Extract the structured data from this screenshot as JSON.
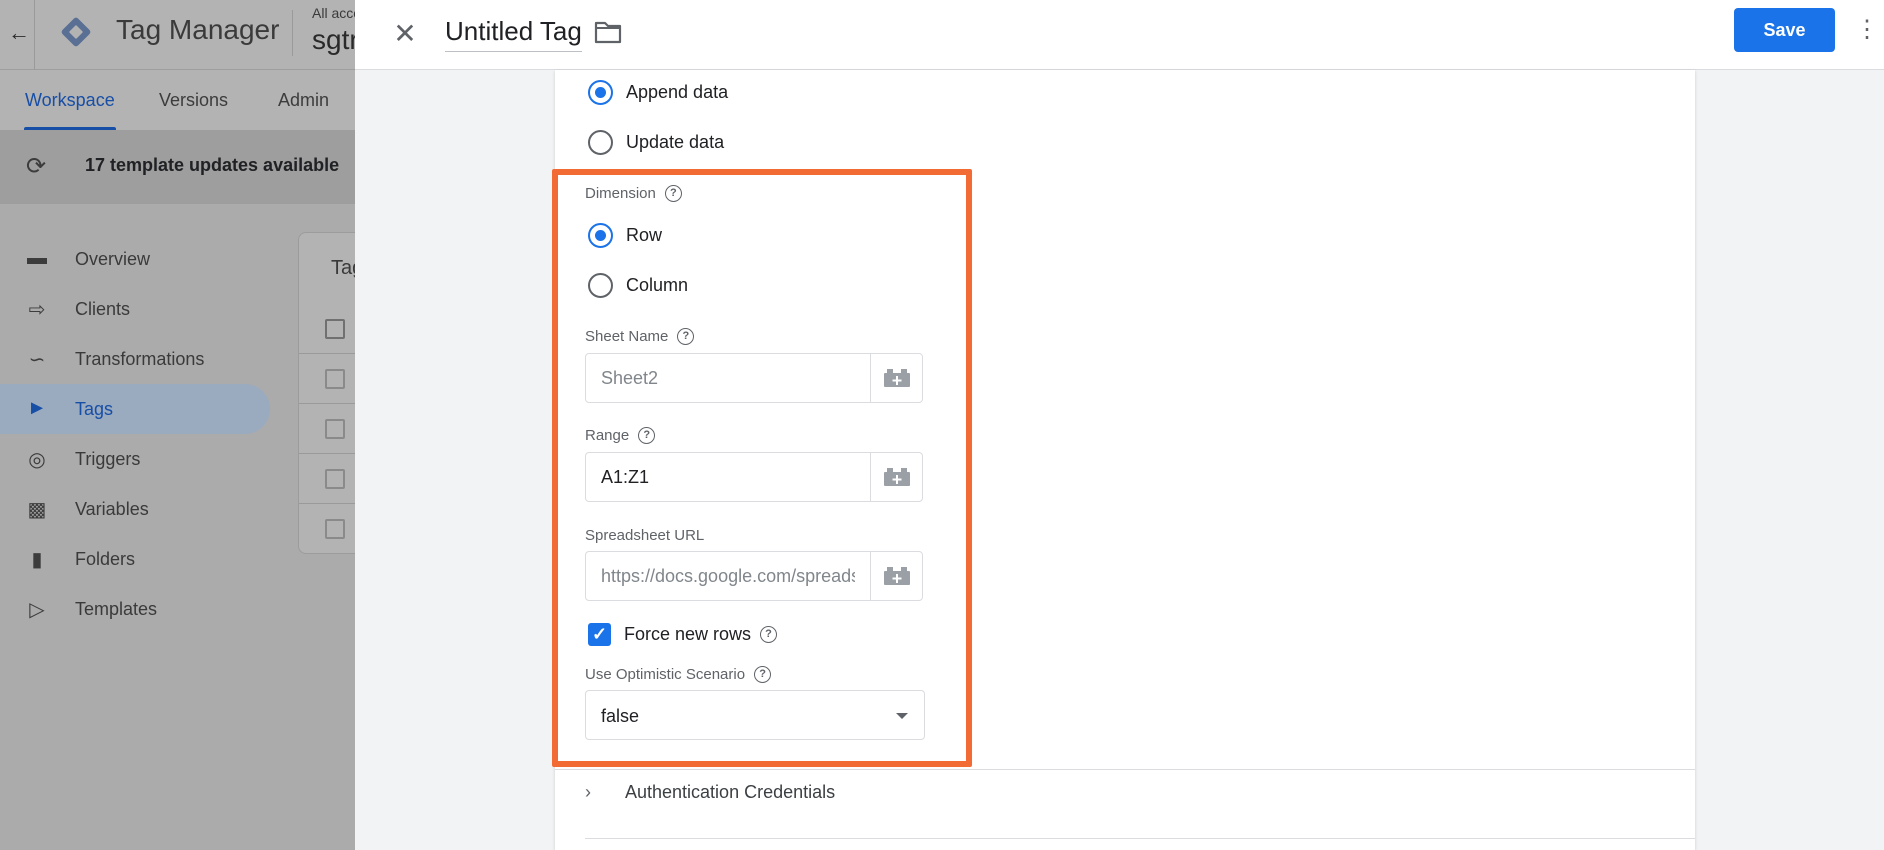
{
  "background": {
    "app_name": "Tag Manager",
    "account_small": "All acco",
    "account_big": "sgtr",
    "tabs": [
      {
        "label": "Workspace",
        "active": true
      },
      {
        "label": "Versions",
        "active": false
      },
      {
        "label": "Admin",
        "active": false
      }
    ],
    "updates_text": "17 template updates available",
    "nav": [
      {
        "label": "Overview",
        "icon": "briefcase-icon"
      },
      {
        "label": "Clients",
        "icon": "login-icon"
      },
      {
        "label": "Transformations",
        "icon": "transform-icon"
      },
      {
        "label": "Tags",
        "icon": "tag-icon",
        "active": true
      },
      {
        "label": "Triggers",
        "icon": "trigger-icon"
      },
      {
        "label": "Variables",
        "icon": "variables-icon"
      },
      {
        "label": "Folders",
        "icon": "folder-icon"
      },
      {
        "label": "Templates",
        "icon": "template-icon"
      }
    ],
    "card_title": "Tag"
  },
  "panel": {
    "title": "Untitled Tag",
    "save_label": "Save",
    "mode_options": [
      {
        "label": "Append data",
        "checked": true
      },
      {
        "label": "Update data",
        "checked": false
      }
    ],
    "dimension": {
      "label": "Dimension",
      "options": [
        {
          "label": "Row",
          "checked": true
        },
        {
          "label": "Column",
          "checked": false
        }
      ]
    },
    "sheet_name": {
      "label": "Sheet Name",
      "value": "",
      "placeholder": "Sheet2"
    },
    "range": {
      "label": "Range",
      "value": "A1:Z1",
      "placeholder": ""
    },
    "spreadsheet_url": {
      "label": "Spreadsheet URL",
      "value": "",
      "placeholder": "https://docs.google.com/spreadsheets/d/"
    },
    "force_new_rows": {
      "label": "Force new rows",
      "checked": true
    },
    "optimistic": {
      "label": "Use Optimistic Scenario",
      "value": "false"
    },
    "auth_section": "Authentication Credentials",
    "colors": {
      "accent": "#1a73e8",
      "highlight": "#f26b35"
    }
  }
}
